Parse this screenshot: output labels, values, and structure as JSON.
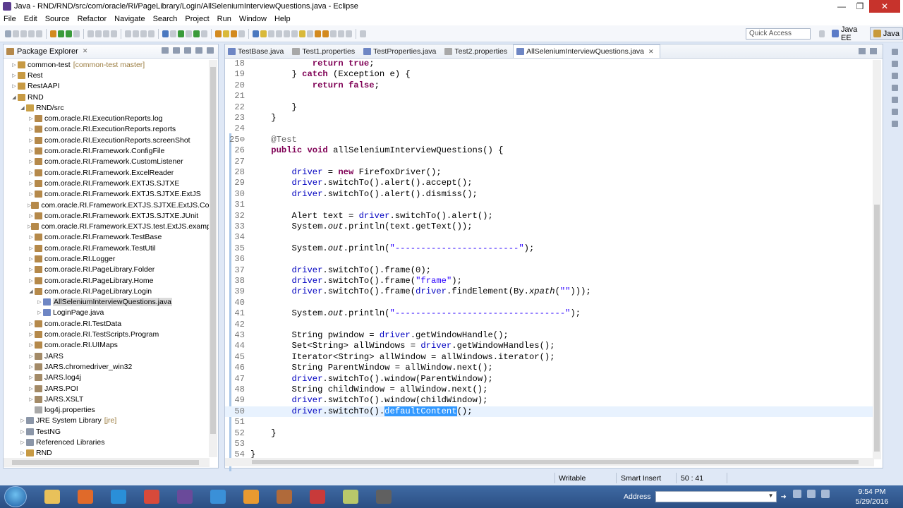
{
  "window": {
    "title": "Java - RND/RND/src/com/oracle/RI/PageLibrary/Login/AllSeleniumInterviewQuestions.java - Eclipse",
    "min": "—",
    "max": "❐",
    "close": "✕"
  },
  "menu": [
    "File",
    "Edit",
    "Source",
    "Refactor",
    "Navigate",
    "Search",
    "Project",
    "Run",
    "Window",
    "Help"
  ],
  "quick_access": {
    "placeholder": "Quick Access"
  },
  "perspectives": [
    {
      "label": "Java EE",
      "color": "#5c7cc8"
    },
    {
      "label": "Java",
      "color": "#c89a3a",
      "active": true
    }
  ],
  "package_explorer": {
    "title": "Package Explorer",
    "items": [
      {
        "indent": 1,
        "tw": "▷",
        "icon": "proj",
        "label": "common-test",
        "suffix": "[common-test master]"
      },
      {
        "indent": 1,
        "tw": "▷",
        "icon": "proj",
        "label": "Rest"
      },
      {
        "indent": 1,
        "tw": "▷",
        "icon": "proj",
        "label": "RestAAPI"
      },
      {
        "indent": 1,
        "tw": "◢",
        "icon": "proj",
        "label": "RND"
      },
      {
        "indent": 2,
        "tw": "◢",
        "icon": "src",
        "label": "RND/src"
      },
      {
        "indent": 3,
        "tw": "▷",
        "icon": "pkg",
        "label": "com.oracle.RI.ExecutionReports.log"
      },
      {
        "indent": 3,
        "tw": "▷",
        "icon": "pkg",
        "label": "com.oracle.RI.ExecutionReports.reports"
      },
      {
        "indent": 3,
        "tw": "▷",
        "icon": "pkg",
        "label": "com.oracle.RI.ExecutionReports.screenShot"
      },
      {
        "indent": 3,
        "tw": "▷",
        "icon": "pkg",
        "label": "com.oracle.RI.Framework.ConfigFile"
      },
      {
        "indent": 3,
        "tw": "▷",
        "icon": "pkg",
        "label": "com.oracle.RI.Framework.CustomListener"
      },
      {
        "indent": 3,
        "tw": "▷",
        "icon": "pkg",
        "label": "com.oracle.RI.Framework.ExcelReader"
      },
      {
        "indent": 3,
        "tw": "▷",
        "icon": "pkg",
        "label": "com.oracle.RI.Framework.EXTJS.SJTXE"
      },
      {
        "indent": 3,
        "tw": "▷",
        "icon": "pkg",
        "label": "com.oracle.RI.Framework.EXTJS.SJTXE.ExtJS"
      },
      {
        "indent": 3,
        "tw": "▷",
        "icon": "pkg",
        "label": "com.oracle.RI.Framework.EXTJS.SJTXE.ExtJS.Compone"
      },
      {
        "indent": 3,
        "tw": "▷",
        "icon": "pkg",
        "label": "com.oracle.RI.Framework.EXTJS.SJTXE.JUnit"
      },
      {
        "indent": 3,
        "tw": "▷",
        "icon": "pkg",
        "label": "com.oracle.RI.Framework.EXTJS.test.ExtJS.examples.xt"
      },
      {
        "indent": 3,
        "tw": "▷",
        "icon": "pkg",
        "label": "com.oracle.RI.Framework.TestBase"
      },
      {
        "indent": 3,
        "tw": "▷",
        "icon": "pkg",
        "label": "com.oracle.RI.Framework.TestUtil"
      },
      {
        "indent": 3,
        "tw": "▷",
        "icon": "pkg",
        "label": "com.oracle.RI.Logger"
      },
      {
        "indent": 3,
        "tw": "▷",
        "icon": "pkg",
        "label": "com.oracle.RI.PageLibrary.Folder"
      },
      {
        "indent": 3,
        "tw": "▷",
        "icon": "pkg",
        "label": "com.oracle.RI.PageLibrary.Home"
      },
      {
        "indent": 3,
        "tw": "◢",
        "icon": "pkg",
        "label": "com.oracle.RI.PageLibrary.Login"
      },
      {
        "indent": 4,
        "tw": "▷",
        "icon": "file",
        "label": "AllSeleniumInterviewQuestions.java",
        "selected": true
      },
      {
        "indent": 4,
        "tw": "▷",
        "icon": "file",
        "label": "LoginPage.java"
      },
      {
        "indent": 3,
        "tw": "▷",
        "icon": "pkg",
        "label": "com.oracle.RI.TestData"
      },
      {
        "indent": 3,
        "tw": "▷",
        "icon": "pkg",
        "label": "com.oracle.RI.TestScripts.Program"
      },
      {
        "indent": 3,
        "tw": "▷",
        "icon": "pkg",
        "label": "com.oracle.RI.UIMaps"
      },
      {
        "indent": 3,
        "tw": "▷",
        "icon": "jar",
        "label": "JARS"
      },
      {
        "indent": 3,
        "tw": "▷",
        "icon": "jar",
        "label": "JARS.chromedriver_win32"
      },
      {
        "indent": 3,
        "tw": "▷",
        "icon": "jar",
        "label": "JARS.log4j"
      },
      {
        "indent": 3,
        "tw": "▷",
        "icon": "jar",
        "label": "JARS.POI"
      },
      {
        "indent": 3,
        "tw": "▷",
        "icon": "jar",
        "label": "JARS.XSLT"
      },
      {
        "indent": 3,
        "tw": "",
        "icon": "prop",
        "label": "log4j.properties"
      },
      {
        "indent": 2,
        "tw": "▷",
        "icon": "lib",
        "label": "JRE System Library",
        "suffix": "[jre]"
      },
      {
        "indent": 2,
        "tw": "▷",
        "icon": "lib",
        "label": "TestNG"
      },
      {
        "indent": 2,
        "tw": "▷",
        "icon": "lib",
        "label": "Referenced Libraries"
      },
      {
        "indent": 2,
        "tw": "▷",
        "icon": "proj",
        "label": "RND"
      }
    ]
  },
  "editor": {
    "tabs": [
      {
        "label": "TestBase.java",
        "icon": "file"
      },
      {
        "label": "Test1.properties",
        "icon": "prop"
      },
      {
        "label": "TestProperties.java",
        "icon": "file"
      },
      {
        "label": "Test2.properties",
        "icon": "prop"
      },
      {
        "label": "AllSeleniumInterviewQuestions.java",
        "icon": "file",
        "active": true
      }
    ],
    "lines": [
      {
        "n": "18",
        "segs": [
          [
            "p",
            "            "
          ],
          [
            "kw",
            "return"
          ],
          [
            "p",
            " "
          ],
          [
            "kw",
            "true"
          ],
          [
            "p",
            ";"
          ]
        ]
      },
      {
        "n": "19",
        "segs": [
          [
            "p",
            "        } "
          ],
          [
            "kw",
            "catch"
          ],
          [
            "p",
            " (Exception e) {"
          ]
        ]
      },
      {
        "n": "20",
        "segs": [
          [
            "p",
            "            "
          ],
          [
            "kw",
            "return"
          ],
          [
            "p",
            " "
          ],
          [
            "kw",
            "false"
          ],
          [
            "p",
            ";"
          ]
        ]
      },
      {
        "n": "21",
        "segs": []
      },
      {
        "n": "22",
        "segs": [
          [
            "p",
            "        }"
          ]
        ]
      },
      {
        "n": "23",
        "segs": [
          [
            "p",
            "    }"
          ]
        ]
      },
      {
        "n": "24",
        "segs": []
      },
      {
        "n": "25⊖",
        "segs": [
          [
            "ann",
            "    @Test"
          ]
        ]
      },
      {
        "n": "26",
        "segs": [
          [
            "p",
            "    "
          ],
          [
            "kw",
            "public"
          ],
          [
            "p",
            " "
          ],
          [
            "kw",
            "void"
          ],
          [
            "p",
            " allSeleniumInterviewQuestions() {"
          ]
        ]
      },
      {
        "n": "27",
        "segs": []
      },
      {
        "n": "28",
        "segs": [
          [
            "p",
            "        "
          ],
          [
            "fld",
            "driver"
          ],
          [
            "p",
            " = "
          ],
          [
            "kw",
            "new"
          ],
          [
            "p",
            " FirefoxDriver();"
          ]
        ]
      },
      {
        "n": "29",
        "segs": [
          [
            "p",
            "        "
          ],
          [
            "fld",
            "driver"
          ],
          [
            "p",
            ".switchTo().alert().accept();"
          ]
        ]
      },
      {
        "n": "30",
        "segs": [
          [
            "p",
            "        "
          ],
          [
            "fld",
            "driver"
          ],
          [
            "p",
            ".switchTo().alert().dismiss();"
          ]
        ]
      },
      {
        "n": "31",
        "segs": []
      },
      {
        "n": "32",
        "segs": [
          [
            "p",
            "        Alert text = "
          ],
          [
            "fld",
            "driver"
          ],
          [
            "p",
            ".switchTo().alert();"
          ]
        ]
      },
      {
        "n": "33",
        "segs": [
          [
            "p",
            "        System."
          ],
          [
            "it",
            "out"
          ],
          [
            "p",
            ".println(text.getText());"
          ]
        ]
      },
      {
        "n": "34",
        "segs": []
      },
      {
        "n": "35",
        "segs": [
          [
            "p",
            "        System."
          ],
          [
            "it",
            "out"
          ],
          [
            "p",
            ".println("
          ],
          [
            "str",
            "\"------------------------\""
          ],
          [
            "p",
            ");"
          ]
        ]
      },
      {
        "n": "36",
        "segs": []
      },
      {
        "n": "37",
        "segs": [
          [
            "p",
            "        "
          ],
          [
            "fld",
            "driver"
          ],
          [
            "p",
            ".switchTo().frame(0);"
          ]
        ]
      },
      {
        "n": "38",
        "segs": [
          [
            "p",
            "        "
          ],
          [
            "fld",
            "driver"
          ],
          [
            "p",
            ".switchTo().frame("
          ],
          [
            "str",
            "\"frame\""
          ],
          [
            "p",
            ");"
          ]
        ]
      },
      {
        "n": "39",
        "segs": [
          [
            "p",
            "        "
          ],
          [
            "fld",
            "driver"
          ],
          [
            "p",
            ".switchTo().frame("
          ],
          [
            "fld",
            "driver"
          ],
          [
            "p",
            ".findElement(By."
          ],
          [
            "it",
            "xpath"
          ],
          [
            "p",
            "("
          ],
          [
            "str",
            "\"\""
          ],
          [
            "p",
            ")));"
          ]
        ]
      },
      {
        "n": "40",
        "segs": []
      },
      {
        "n": "41",
        "segs": [
          [
            "p",
            "        System."
          ],
          [
            "it",
            "out"
          ],
          [
            "p",
            ".println("
          ],
          [
            "str",
            "\"---------------------------------\""
          ],
          [
            "p",
            ");"
          ]
        ]
      },
      {
        "n": "42",
        "segs": []
      },
      {
        "n": "43",
        "segs": [
          [
            "p",
            "        String pwindow = "
          ],
          [
            "fld",
            "driver"
          ],
          [
            "p",
            ".getWindowHandle();"
          ]
        ]
      },
      {
        "n": "44",
        "segs": [
          [
            "p",
            "        Set<String> allWindows = "
          ],
          [
            "fld",
            "driver"
          ],
          [
            "p",
            ".getWindowHandles();"
          ]
        ]
      },
      {
        "n": "45",
        "segs": [
          [
            "p",
            "        Iterator<String> allWindow = allWindows.iterator();"
          ]
        ]
      },
      {
        "n": "46",
        "segs": [
          [
            "p",
            "        String ParentWindow = allWindow.next();"
          ]
        ]
      },
      {
        "n": "47",
        "segs": [
          [
            "p",
            "        "
          ],
          [
            "fld",
            "driver"
          ],
          [
            "p",
            ".switchTo().window(ParentWindow);"
          ]
        ]
      },
      {
        "n": "48",
        "segs": [
          [
            "p",
            "        String childWindow = allWindow.next();"
          ]
        ]
      },
      {
        "n": "49",
        "segs": [
          [
            "p",
            "        "
          ],
          [
            "fld",
            "driver"
          ],
          [
            "p",
            ".switchTo().window(childWindow);"
          ]
        ]
      },
      {
        "n": "50",
        "current": true,
        "segs": [
          [
            "p",
            "        "
          ],
          [
            "fld",
            "driver"
          ],
          [
            "p",
            ".switchTo()."
          ],
          [
            "hl",
            "defaultContent"
          ],
          [
            "p",
            "();"
          ]
        ]
      },
      {
        "n": "51",
        "segs": []
      },
      {
        "n": "52",
        "segs": [
          [
            "p",
            "    }"
          ]
        ]
      },
      {
        "n": "53",
        "segs": []
      },
      {
        "n": "54",
        "segs": [
          [
            "p",
            "}"
          ]
        ]
      }
    ]
  },
  "status": {
    "writable": "Writable",
    "insert_mode": "Smart Insert",
    "position": "50 : 41"
  },
  "taskbar": {
    "apps": [
      {
        "name": "explorer",
        "color": "#e8c15a"
      },
      {
        "name": "media",
        "color": "#e06a2a"
      },
      {
        "name": "skype",
        "color": "#2a8fd8"
      },
      {
        "name": "chrome",
        "color": "#d84a3a"
      },
      {
        "name": "eclipse",
        "color": "#6a4a9a"
      },
      {
        "name": "ie",
        "color": "#3a90d8"
      },
      {
        "name": "outlook",
        "color": "#e89a30"
      },
      {
        "name": "app",
        "color": "#b06a3a"
      },
      {
        "name": "pdf",
        "color": "#c83a3a"
      },
      {
        "name": "notes",
        "color": "#b8c86a"
      },
      {
        "name": "tool",
        "color": "#606060"
      }
    ],
    "address_label": "Address",
    "time": "9:54 PM",
    "date": "5/29/2016"
  }
}
